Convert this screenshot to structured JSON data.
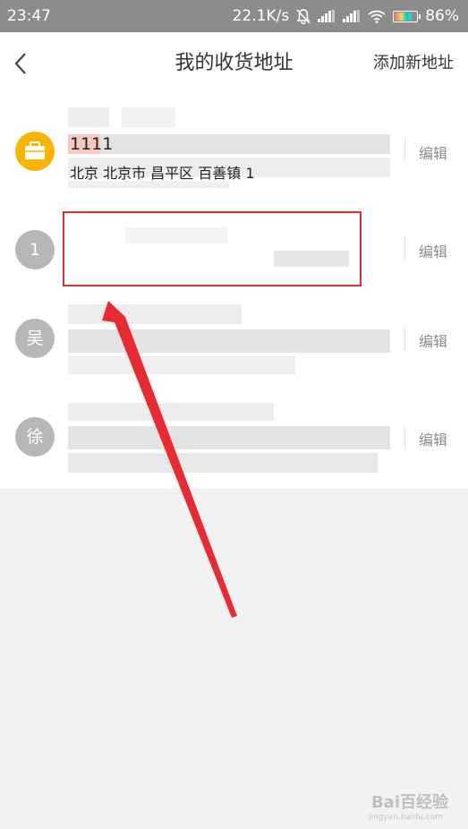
{
  "status_bar": {
    "time": "23:47",
    "speed": "22.1K/s",
    "battery": "86%",
    "battery_level": 0.86,
    "icons": [
      "alarm-off-icon",
      "signal-icon",
      "signal-icon",
      "wifi-icon",
      "battery-icon"
    ]
  },
  "nav": {
    "back_icon": "chevron-left-icon",
    "title": "我的收货地址",
    "add_label": "添加新地址"
  },
  "addresses": [
    {
      "avatar_icon": "briefcase-icon",
      "name": "",
      "detail": "",
      "edit_label": "编辑"
    },
    {
      "avatar_text": "1",
      "name": "1111",
      "detail": "北京 北京市 昌平区 百善镇 1",
      "edit_label": "编辑"
    },
    {
      "avatar_text": "吴",
      "name": "",
      "detail": "",
      "edit_label": "编辑"
    },
    {
      "avatar_text": "徐",
      "name": "",
      "detail": "",
      "edit_label": "编辑"
    }
  ],
  "colors": {
    "status_bar": "#8c8c8c",
    "avatar_default": "#b7b7b7",
    "avatar_highlight": "#f7b500",
    "annotation_red": "#e03137"
  },
  "watermark": {
    "text": "Bai百经验",
    "sub": "jingyan.baidu.com"
  }
}
